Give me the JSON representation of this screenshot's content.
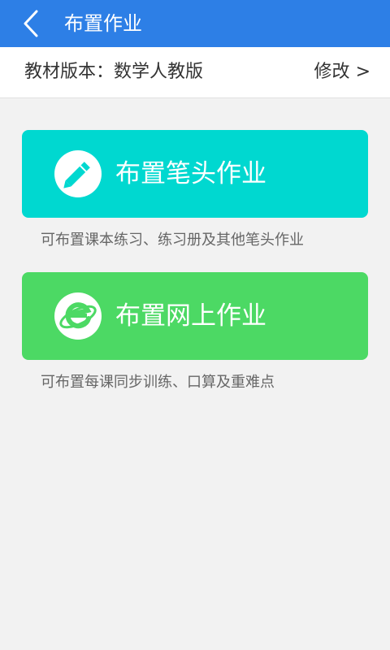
{
  "header": {
    "title": "布置作业",
    "back_icon": "chevron-left-icon",
    "background": "#2d7fe6"
  },
  "textbook": {
    "label": "教材版本：数学人教版",
    "modify_label": "修改",
    "modify_arrow": ">"
  },
  "cards": {
    "pen": {
      "label": "布置笔头作业",
      "description": "可布置课本练习、练习册及其他笔头作业",
      "icon": "pencil-icon",
      "color": "#00d8d0"
    },
    "online": {
      "label": "布置网上作业",
      "description": "可布置每课同步训练、口算及重难点",
      "icon": "internet-explorer-icon",
      "color": "#4cd964"
    }
  }
}
